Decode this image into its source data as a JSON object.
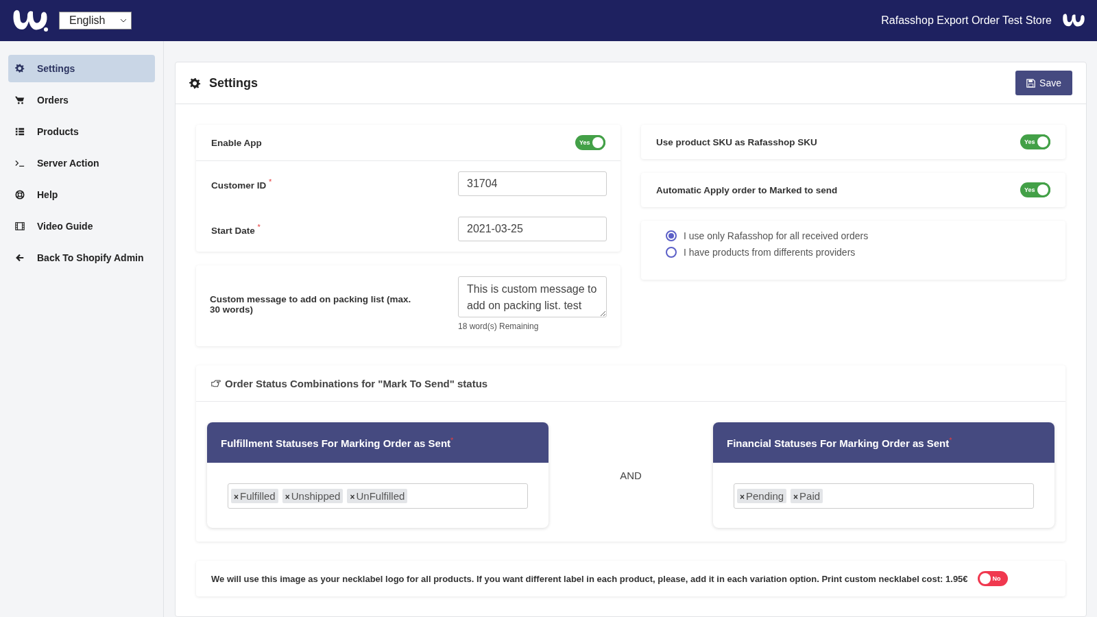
{
  "header": {
    "language": "English",
    "store_name": "Rafasshop Export Order Test Store"
  },
  "sidebar": {
    "items": [
      {
        "label": "Settings",
        "kind": "gear",
        "selected": true
      },
      {
        "label": "Orders",
        "kind": "cart",
        "selected": false
      },
      {
        "label": "Products",
        "kind": "list",
        "selected": false
      },
      {
        "label": "Server Action",
        "kind": "terminal",
        "selected": false
      },
      {
        "label": "Help",
        "kind": "lifebuoy",
        "selected": false
      },
      {
        "label": "Video Guide",
        "kind": "film",
        "selected": false
      },
      {
        "label": "Back To Shopify Admin",
        "kind": "arrow",
        "selected": false
      }
    ]
  },
  "panel": {
    "title": "Settings",
    "save_button": "Save"
  },
  "enable_app": {
    "label": "Enable App",
    "on": true,
    "toggle_text": "Yes"
  },
  "fields": [
    {
      "label": "Customer ID",
      "required_mark": "*",
      "value": "31704"
    },
    {
      "label": "Start Date",
      "required_mark": "*",
      "value": "2021-03-25"
    }
  ],
  "custom_message": {
    "label": "Custom message to add on packing list (max. 30 words)",
    "value": "This is custom message to add on packing list. test",
    "hint": "18 word(s) Remaining"
  },
  "right_toggles": [
    {
      "label": "Use product SKU as Rafasshop SKU",
      "on": true,
      "toggle_text": "Yes"
    },
    {
      "label": "Automatic Apply order to Marked to send",
      "on": true,
      "toggle_text": "Yes"
    }
  ],
  "provider_options": [
    {
      "label": "I use only Rafasshop for all received orders",
      "selected": true
    },
    {
      "label": "I have products from differents providers",
      "selected": false
    }
  ],
  "status_combinations": {
    "title": "Order Status Combinations for \"Mark To Send\" status",
    "joiner": "AND",
    "groups": [
      {
        "title": "Fulfillment Statuses For Marking Order as Sent",
        "required_mark": "*",
        "tags": [
          {
            "remove": "×",
            "label": "Fulfilled"
          },
          {
            "remove": "×",
            "label": "Unshipped"
          },
          {
            "remove": "×",
            "label": "UnFulfilled"
          }
        ]
      },
      {
        "title": "Financial Statuses For Marking Order as Sent",
        "required_mark": "*",
        "tags": [
          {
            "remove": "×",
            "label": "Pending"
          },
          {
            "remove": "×",
            "label": "Paid"
          }
        ]
      }
    ]
  },
  "necklabel": {
    "text": "We will use this image as your necklabel logo for all products. If you want different label in each product, please, add it in each variation option. Print custom necklabel cost: 1.95€",
    "on": false,
    "toggle_text": "No"
  }
}
